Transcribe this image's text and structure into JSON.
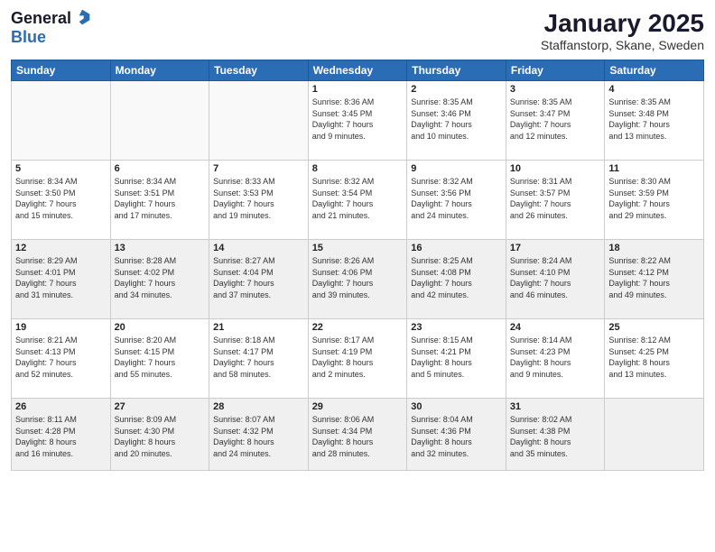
{
  "logo": {
    "general": "General",
    "blue": "Blue"
  },
  "header": {
    "month": "January 2025",
    "location": "Staffanstorp, Skane, Sweden"
  },
  "weekdays": [
    "Sunday",
    "Monday",
    "Tuesday",
    "Wednesday",
    "Thursday",
    "Friday",
    "Saturday"
  ],
  "weeks": [
    [
      {
        "day": "",
        "info": ""
      },
      {
        "day": "",
        "info": ""
      },
      {
        "day": "",
        "info": ""
      },
      {
        "day": "1",
        "info": "Sunrise: 8:36 AM\nSunset: 3:45 PM\nDaylight: 7 hours\nand 9 minutes."
      },
      {
        "day": "2",
        "info": "Sunrise: 8:35 AM\nSunset: 3:46 PM\nDaylight: 7 hours\nand 10 minutes."
      },
      {
        "day": "3",
        "info": "Sunrise: 8:35 AM\nSunset: 3:47 PM\nDaylight: 7 hours\nand 12 minutes."
      },
      {
        "day": "4",
        "info": "Sunrise: 8:35 AM\nSunset: 3:48 PM\nDaylight: 7 hours\nand 13 minutes."
      }
    ],
    [
      {
        "day": "5",
        "info": "Sunrise: 8:34 AM\nSunset: 3:50 PM\nDaylight: 7 hours\nand 15 minutes."
      },
      {
        "day": "6",
        "info": "Sunrise: 8:34 AM\nSunset: 3:51 PM\nDaylight: 7 hours\nand 17 minutes."
      },
      {
        "day": "7",
        "info": "Sunrise: 8:33 AM\nSunset: 3:53 PM\nDaylight: 7 hours\nand 19 minutes."
      },
      {
        "day": "8",
        "info": "Sunrise: 8:32 AM\nSunset: 3:54 PM\nDaylight: 7 hours\nand 21 minutes."
      },
      {
        "day": "9",
        "info": "Sunrise: 8:32 AM\nSunset: 3:56 PM\nDaylight: 7 hours\nand 24 minutes."
      },
      {
        "day": "10",
        "info": "Sunrise: 8:31 AM\nSunset: 3:57 PM\nDaylight: 7 hours\nand 26 minutes."
      },
      {
        "day": "11",
        "info": "Sunrise: 8:30 AM\nSunset: 3:59 PM\nDaylight: 7 hours\nand 29 minutes."
      }
    ],
    [
      {
        "day": "12",
        "info": "Sunrise: 8:29 AM\nSunset: 4:01 PM\nDaylight: 7 hours\nand 31 minutes."
      },
      {
        "day": "13",
        "info": "Sunrise: 8:28 AM\nSunset: 4:02 PM\nDaylight: 7 hours\nand 34 minutes."
      },
      {
        "day": "14",
        "info": "Sunrise: 8:27 AM\nSunset: 4:04 PM\nDaylight: 7 hours\nand 37 minutes."
      },
      {
        "day": "15",
        "info": "Sunrise: 8:26 AM\nSunset: 4:06 PM\nDaylight: 7 hours\nand 39 minutes."
      },
      {
        "day": "16",
        "info": "Sunrise: 8:25 AM\nSunset: 4:08 PM\nDaylight: 7 hours\nand 42 minutes."
      },
      {
        "day": "17",
        "info": "Sunrise: 8:24 AM\nSunset: 4:10 PM\nDaylight: 7 hours\nand 46 minutes."
      },
      {
        "day": "18",
        "info": "Sunrise: 8:22 AM\nSunset: 4:12 PM\nDaylight: 7 hours\nand 49 minutes."
      }
    ],
    [
      {
        "day": "19",
        "info": "Sunrise: 8:21 AM\nSunset: 4:13 PM\nDaylight: 7 hours\nand 52 minutes."
      },
      {
        "day": "20",
        "info": "Sunrise: 8:20 AM\nSunset: 4:15 PM\nDaylight: 7 hours\nand 55 minutes."
      },
      {
        "day": "21",
        "info": "Sunrise: 8:18 AM\nSunset: 4:17 PM\nDaylight: 7 hours\nand 58 minutes."
      },
      {
        "day": "22",
        "info": "Sunrise: 8:17 AM\nSunset: 4:19 PM\nDaylight: 8 hours\nand 2 minutes."
      },
      {
        "day": "23",
        "info": "Sunrise: 8:15 AM\nSunset: 4:21 PM\nDaylight: 8 hours\nand 5 minutes."
      },
      {
        "day": "24",
        "info": "Sunrise: 8:14 AM\nSunset: 4:23 PM\nDaylight: 8 hours\nand 9 minutes."
      },
      {
        "day": "25",
        "info": "Sunrise: 8:12 AM\nSunset: 4:25 PM\nDaylight: 8 hours\nand 13 minutes."
      }
    ],
    [
      {
        "day": "26",
        "info": "Sunrise: 8:11 AM\nSunset: 4:28 PM\nDaylight: 8 hours\nand 16 minutes."
      },
      {
        "day": "27",
        "info": "Sunrise: 8:09 AM\nSunset: 4:30 PM\nDaylight: 8 hours\nand 20 minutes."
      },
      {
        "day": "28",
        "info": "Sunrise: 8:07 AM\nSunset: 4:32 PM\nDaylight: 8 hours\nand 24 minutes."
      },
      {
        "day": "29",
        "info": "Sunrise: 8:06 AM\nSunset: 4:34 PM\nDaylight: 8 hours\nand 28 minutes."
      },
      {
        "day": "30",
        "info": "Sunrise: 8:04 AM\nSunset: 4:36 PM\nDaylight: 8 hours\nand 32 minutes."
      },
      {
        "day": "31",
        "info": "Sunrise: 8:02 AM\nSunset: 4:38 PM\nDaylight: 8 hours\nand 35 minutes."
      },
      {
        "day": "",
        "info": ""
      }
    ]
  ]
}
